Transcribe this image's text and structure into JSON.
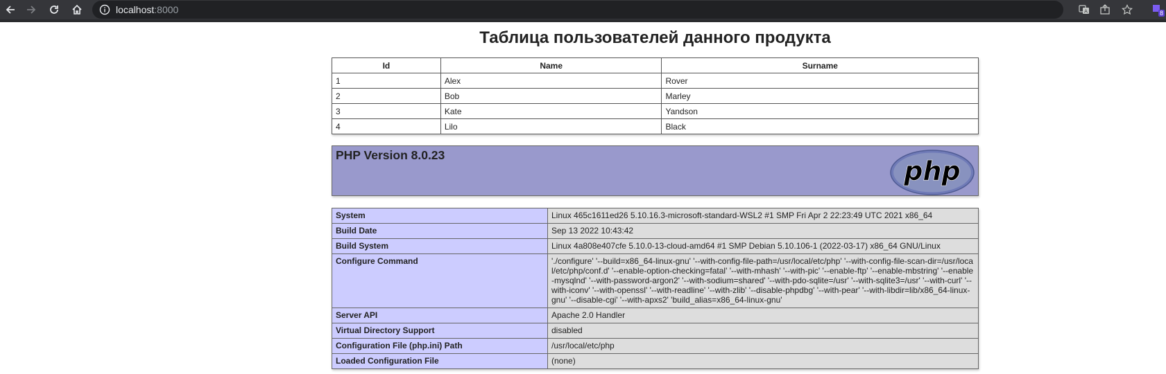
{
  "browser": {
    "url_host": "localhost",
    "url_port": ":8000",
    "extension_badge": "8"
  },
  "page": {
    "title": "Таблица пользователей данного продукта"
  },
  "users_table": {
    "headers": [
      "Id",
      "Name",
      "Surname"
    ],
    "rows": [
      [
        "1",
        "Alex",
        "Rover"
      ],
      [
        "2",
        "Bob",
        "Marley"
      ],
      [
        "3",
        "Kate",
        "Yandson"
      ],
      [
        "4",
        "Lilo",
        "Black"
      ]
    ]
  },
  "phpinfo": {
    "version_title": "PHP Version 8.0.23",
    "logo_text": "php",
    "rows": [
      [
        "System",
        "Linux 465c1611ed26 5.10.16.3-microsoft-standard-WSL2 #1 SMP Fri Apr 2 22:23:49 UTC 2021 x86_64"
      ],
      [
        "Build Date",
        "Sep 13 2022 10:43:42"
      ],
      [
        "Build System",
        "Linux 4a808e407cfe 5.10.0-13-cloud-amd64 #1 SMP Debian 5.10.106-1 (2022-03-17) x86_64 GNU/Linux"
      ],
      [
        "Configure Command",
        "'./configure' '--build=x86_64-linux-gnu' '--with-config-file-path=/usr/local/etc/php' '--with-config-file-scan-dir=/usr/local/etc/php/conf.d' '--enable-option-checking=fatal' '--with-mhash' '--with-pic' '--enable-ftp' '--enable-mbstring' '--enable-mysqlnd' '--with-password-argon2' '--with-sodium=shared' '--with-pdo-sqlite=/usr' '--with-sqlite3=/usr' '--with-curl' '--with-iconv' '--with-openssl' '--with-readline' '--with-zlib' '--disable-phpdbg' '--with-pear' '--with-libdir=lib/x86_64-linux-gnu' '--disable-cgi' '--with-apxs2' 'build_alias=x86_64-linux-gnu'"
      ],
      [
        "Server API",
        "Apache 2.0 Handler"
      ],
      [
        "Virtual Directory Support",
        "disabled"
      ],
      [
        "Configuration File (php.ini) Path",
        "/usr/local/etc/php"
      ],
      [
        "Loaded Configuration File",
        "(none)"
      ]
    ]
  }
}
